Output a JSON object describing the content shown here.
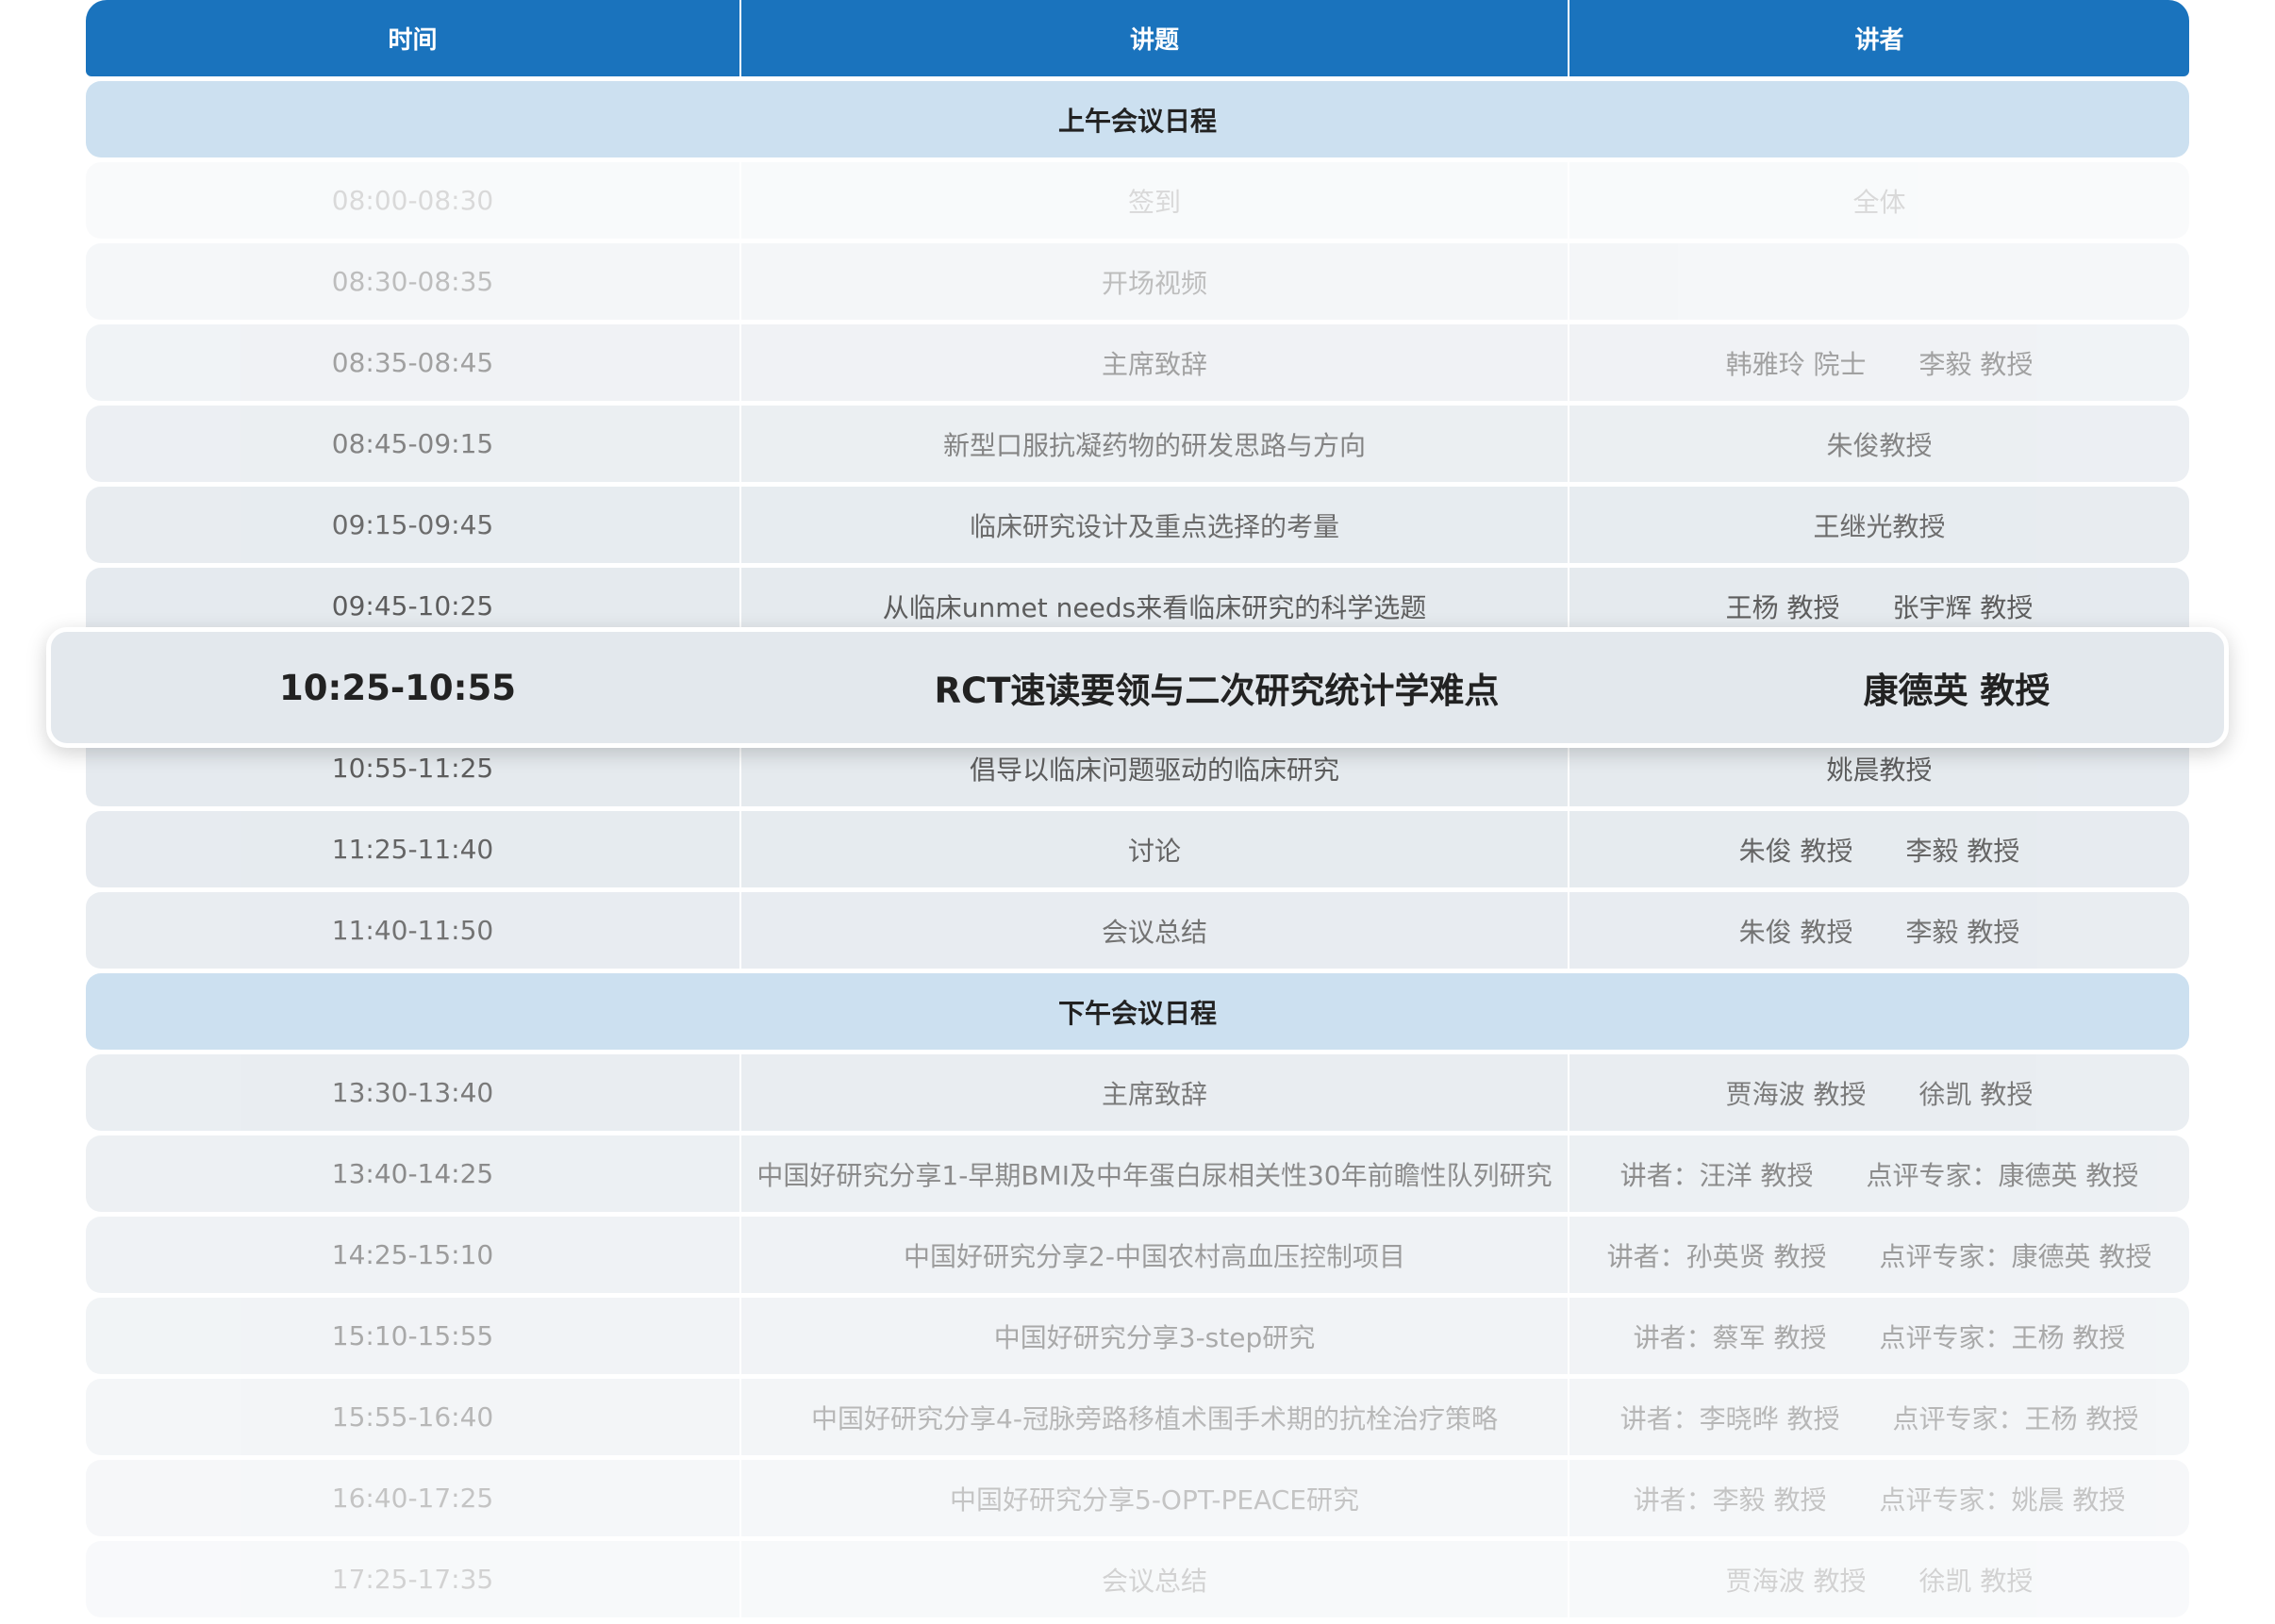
{
  "header": {
    "col_time": "时间",
    "col_topic": "讲题",
    "col_speaker": "讲者"
  },
  "morning": {
    "title": "上午会议日程",
    "rows": [
      {
        "time": "08:00-08:30",
        "topic": "签到",
        "speakers": [
          "全体"
        ]
      },
      {
        "time": "08:30-08:35",
        "topic": "开场视频",
        "speakers": []
      },
      {
        "time": "08:35-08:45",
        "topic": "主席致辞",
        "speakers": [
          "韩雅玲 院士",
          "李毅 教授"
        ]
      },
      {
        "time": "08:45-09:15",
        "topic": "新型口服抗凝药物的研发思路与方向",
        "speakers": [
          "朱俊教授"
        ]
      },
      {
        "time": "09:15-09:45",
        "topic": "临床研究设计及重点选择的考量",
        "speakers": [
          "王继光教授"
        ]
      },
      {
        "time": "09:45-10:25",
        "topic": "从临床unmet needs来看临床研究的科学选题",
        "speakers": [
          "王杨 教授",
          "张宇辉 教授"
        ]
      }
    ]
  },
  "highlight": {
    "time": "10:25-10:55",
    "topic": "RCT速读要领与二次研究统计学难点",
    "speaker": "康德英 教授"
  },
  "morning_after": [
    {
      "time": "10:55-11:25",
      "topic": "倡导以临床问题驱动的临床研究",
      "speakers": [
        "姚晨教授"
      ]
    },
    {
      "time": "11:25-11:40",
      "topic": "讨论",
      "speakers": [
        "朱俊 教授",
        "李毅 教授"
      ]
    },
    {
      "time": "11:40-11:50",
      "topic": "会议总结",
      "speakers": [
        "朱俊 教授",
        "李毅 教授"
      ]
    }
  ],
  "afternoon": {
    "title": "下午会议日程",
    "rows": [
      {
        "time": "13:30-13:40",
        "topic": "主席致辞",
        "speakers": [
          "贾海波 教授",
          "徐凯 教授"
        ]
      },
      {
        "time": "13:40-14:25",
        "topic": "中国好研究分享1-早期BMI及中年蛋白尿相关性30年前瞻性队列研究",
        "speakers": [
          "讲者：汪洋 教授",
          "点评专家：康德英 教授"
        ]
      },
      {
        "time": "14:25-15:10",
        "topic": "中国好研究分享2-中国农村高血压控制项目",
        "speakers": [
          "讲者：孙英贤 教授",
          "点评专家：康德英 教授"
        ]
      },
      {
        "time": "15:10-15:55",
        "topic": "中国好研究分享3-step研究",
        "speakers": [
          "讲者：蔡军 教授",
          "点评专家：王杨 教授"
        ]
      },
      {
        "time": "15:55-16:40",
        "topic": "中国好研究分享4-冠脉旁路移植术围手术期的抗栓治疗策略",
        "speakers": [
          "讲者：李晓晔 教授",
          "点评专家：王杨 教授"
        ]
      },
      {
        "time": "16:40-17:25",
        "topic": "中国好研究分享5-OPT-PEACE研究",
        "speakers": [
          "讲者：李毅 教授",
          "点评专家：姚晨 教授"
        ]
      },
      {
        "time": "17:25-17:35",
        "topic": "会议总结",
        "speakers": [
          "贾海波 教授",
          "徐凯 教授"
        ]
      }
    ]
  },
  "colors": {
    "header_bg": "#1a73bd",
    "section_bg": "#cce0f0",
    "row_bg": "#e4e9ee"
  }
}
